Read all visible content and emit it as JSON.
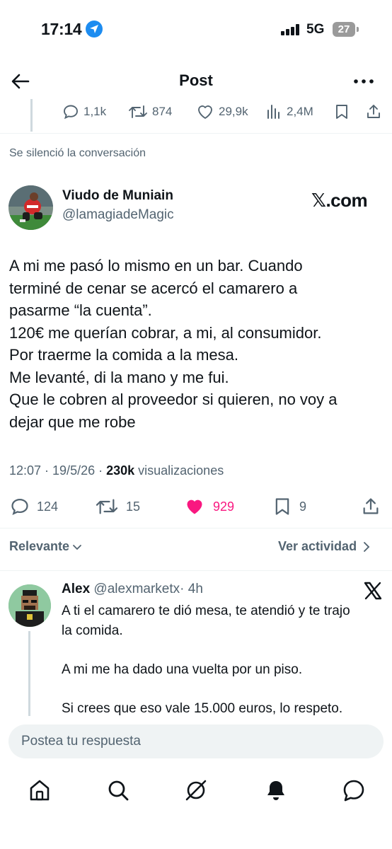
{
  "status_bar": {
    "time": "17:14",
    "network": "5G",
    "battery": "27"
  },
  "header": {
    "title": "Post"
  },
  "previous_tweet": {
    "replies": "1,1k",
    "reposts": "874",
    "likes": "29,9k",
    "views": "2,4M"
  },
  "muted_note": "Se silenció la conversación",
  "tweet": {
    "author_name": "Viudo de Muniain",
    "author_handle": "@lamagiadeMagic",
    "badge": "𝕏.com",
    "lines": [
      "A mi me pasó lo mismo en un bar. Cuando",
      "terminé de cenar se acercó el camarero a",
      "pasarme “la cuenta”.",
      "120€ me querían cobrar, a mi, al consumidor.",
      "Por traerme la comida a la mesa.",
      "Me levanté, di la mano y me fui.",
      "Que le cobren al proveedor si quieren, no voy a",
      "dejar que me robe"
    ],
    "timestamp": "12:07 · 19/5/26 · ",
    "views_count": "230k",
    "views_label": " visualizaciones",
    "replies": "124",
    "reposts": "15",
    "likes": "929",
    "bookmarks": "9"
  },
  "sort": {
    "relevante": "Relevante",
    "ver_actividad": "Ver actividad"
  },
  "reply": {
    "name": "Alex",
    "handle": "@alexmarketx",
    "time": "· 4h",
    "para1": [
      "A ti el camarero te dió mesa, te atendió y te trajo",
      "la comida."
    ],
    "para2": "A mi me ha dado una vuelta por un piso.",
    "para3": "Si crees que eso vale 15.000 euros, lo respeto."
  },
  "compose": {
    "placeholder": "Postea tu respuesta"
  },
  "colors": {
    "like": "#f91880",
    "secondary": "#536471",
    "location": "#1d8cf0"
  }
}
